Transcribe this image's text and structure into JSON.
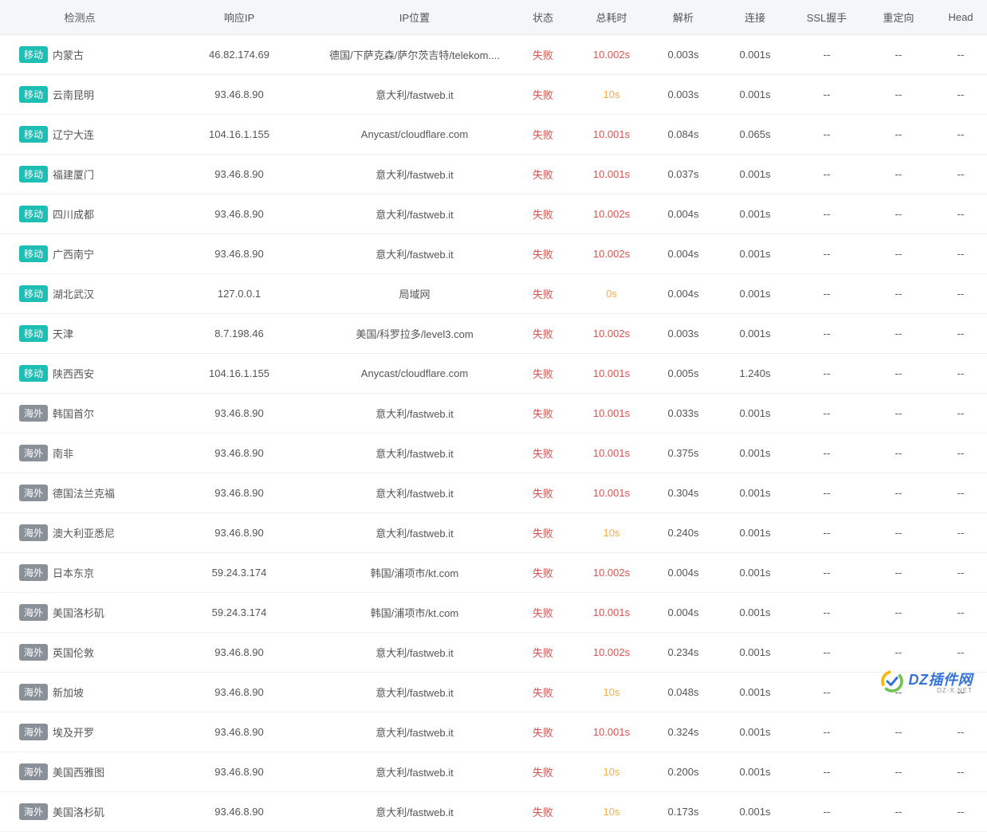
{
  "headers": {
    "checkpoint": "检测点",
    "responseIp": "响应IP",
    "ipLocation": "IP位置",
    "status": "状态",
    "totalTime": "总耗时",
    "resolve": "解析",
    "connect": "连接",
    "sslHandshake": "SSL握手",
    "redirect": "重定向",
    "head": "Head"
  },
  "badgeLabels": {
    "mobile": "移动",
    "overseas": "海外"
  },
  "statusLabels": {
    "fail": "失败"
  },
  "watermark": {
    "main": "DZ插件网",
    "sub": "DZ-X.NET"
  },
  "rows": [
    {
      "badge": "mobile",
      "location": "内蒙古",
      "ip": "46.82.174.69",
      "iploc": "德国/下萨克森/萨尔茨吉特/telekom....",
      "status": "fail",
      "total": "10.002s",
      "totalColor": "red",
      "resolve": "0.003s",
      "connect": "0.001s",
      "ssl": "--",
      "redirect": "--",
      "head": "--"
    },
    {
      "badge": "mobile",
      "location": "云南昆明",
      "ip": "93.46.8.90",
      "iploc": "意大利/fastweb.it",
      "status": "fail",
      "total": "10s",
      "totalColor": "orange",
      "resolve": "0.003s",
      "connect": "0.001s",
      "ssl": "--",
      "redirect": "--",
      "head": "--"
    },
    {
      "badge": "mobile",
      "location": "辽宁大连",
      "ip": "104.16.1.155",
      "iploc": "Anycast/cloudflare.com",
      "status": "fail",
      "total": "10.001s",
      "totalColor": "red",
      "resolve": "0.084s",
      "connect": "0.065s",
      "ssl": "--",
      "redirect": "--",
      "head": "--"
    },
    {
      "badge": "mobile",
      "location": "福建厦门",
      "ip": "93.46.8.90",
      "iploc": "意大利/fastweb.it",
      "status": "fail",
      "total": "10.001s",
      "totalColor": "red",
      "resolve": "0.037s",
      "connect": "0.001s",
      "ssl": "--",
      "redirect": "--",
      "head": "--"
    },
    {
      "badge": "mobile",
      "location": "四川成都",
      "ip": "93.46.8.90",
      "iploc": "意大利/fastweb.it",
      "status": "fail",
      "total": "10.002s",
      "totalColor": "red",
      "resolve": "0.004s",
      "connect": "0.001s",
      "ssl": "--",
      "redirect": "--",
      "head": "--"
    },
    {
      "badge": "mobile",
      "location": "广西南宁",
      "ip": "93.46.8.90",
      "iploc": "意大利/fastweb.it",
      "status": "fail",
      "total": "10.002s",
      "totalColor": "red",
      "resolve": "0.004s",
      "connect": "0.001s",
      "ssl": "--",
      "redirect": "--",
      "head": "--"
    },
    {
      "badge": "mobile",
      "location": "湖北武汉",
      "ip": "127.0.0.1",
      "iploc": "局域网",
      "status": "fail",
      "total": "0s",
      "totalColor": "orange",
      "resolve": "0.004s",
      "connect": "0.001s",
      "ssl": "--",
      "redirect": "--",
      "head": "--"
    },
    {
      "badge": "mobile",
      "location": "天津",
      "ip": "8.7.198.46",
      "iploc": "美国/科罗拉多/level3.com",
      "status": "fail",
      "total": "10.002s",
      "totalColor": "red",
      "resolve": "0.003s",
      "connect": "0.001s",
      "ssl": "--",
      "redirect": "--",
      "head": "--"
    },
    {
      "badge": "mobile",
      "location": "陕西西安",
      "ip": "104.16.1.155",
      "iploc": "Anycast/cloudflare.com",
      "status": "fail",
      "total": "10.001s",
      "totalColor": "red",
      "resolve": "0.005s",
      "connect": "1.240s",
      "ssl": "--",
      "redirect": "--",
      "head": "--"
    },
    {
      "badge": "overseas",
      "location": "韩国首尔",
      "ip": "93.46.8.90",
      "iploc": "意大利/fastweb.it",
      "status": "fail",
      "total": "10.001s",
      "totalColor": "red",
      "resolve": "0.033s",
      "connect": "0.001s",
      "ssl": "--",
      "redirect": "--",
      "head": "--"
    },
    {
      "badge": "overseas",
      "location": "南非",
      "ip": "93.46.8.90",
      "iploc": "意大利/fastweb.it",
      "status": "fail",
      "total": "10.001s",
      "totalColor": "red",
      "resolve": "0.375s",
      "connect": "0.001s",
      "ssl": "--",
      "redirect": "--",
      "head": "--"
    },
    {
      "badge": "overseas",
      "location": "德国法兰克福",
      "ip": "93.46.8.90",
      "iploc": "意大利/fastweb.it",
      "status": "fail",
      "total": "10.001s",
      "totalColor": "red",
      "resolve": "0.304s",
      "connect": "0.001s",
      "ssl": "--",
      "redirect": "--",
      "head": "--"
    },
    {
      "badge": "overseas",
      "location": "澳大利亚悉尼",
      "ip": "93.46.8.90",
      "iploc": "意大利/fastweb.it",
      "status": "fail",
      "total": "10s",
      "totalColor": "orange",
      "resolve": "0.240s",
      "connect": "0.001s",
      "ssl": "--",
      "redirect": "--",
      "head": "--"
    },
    {
      "badge": "overseas",
      "location": "日本东京",
      "ip": "59.24.3.174",
      "iploc": "韩国/浦项市/kt.com",
      "status": "fail",
      "total": "10.002s",
      "totalColor": "red",
      "resolve": "0.004s",
      "connect": "0.001s",
      "ssl": "--",
      "redirect": "--",
      "head": "--"
    },
    {
      "badge": "overseas",
      "location": "美国洛杉矶",
      "ip": "59.24.3.174",
      "iploc": "韩国/浦项市/kt.com",
      "status": "fail",
      "total": "10.001s",
      "totalColor": "red",
      "resolve": "0.004s",
      "connect": "0.001s",
      "ssl": "--",
      "redirect": "--",
      "head": "--"
    },
    {
      "badge": "overseas",
      "location": "英国伦敦",
      "ip": "93.46.8.90",
      "iploc": "意大利/fastweb.it",
      "status": "fail",
      "total": "10.002s",
      "totalColor": "red",
      "resolve": "0.234s",
      "connect": "0.001s",
      "ssl": "--",
      "redirect": "--",
      "head": "--"
    },
    {
      "badge": "overseas",
      "location": "新加坡",
      "ip": "93.46.8.90",
      "iploc": "意大利/fastweb.it",
      "status": "fail",
      "total": "10s",
      "totalColor": "orange",
      "resolve": "0.048s",
      "connect": "0.001s",
      "ssl": "--",
      "redirect": "--",
      "head": "--"
    },
    {
      "badge": "overseas",
      "location": "埃及开罗",
      "ip": "93.46.8.90",
      "iploc": "意大利/fastweb.it",
      "status": "fail",
      "total": "10.001s",
      "totalColor": "red",
      "resolve": "0.324s",
      "connect": "0.001s",
      "ssl": "--",
      "redirect": "--",
      "head": "--"
    },
    {
      "badge": "overseas",
      "location": "美国西雅图",
      "ip": "93.46.8.90",
      "iploc": "意大利/fastweb.it",
      "status": "fail",
      "total": "10s",
      "totalColor": "orange",
      "resolve": "0.200s",
      "connect": "0.001s",
      "ssl": "--",
      "redirect": "--",
      "head": "--"
    },
    {
      "badge": "overseas",
      "location": "美国洛杉矶",
      "ip": "93.46.8.90",
      "iploc": "意大利/fastweb.it",
      "status": "fail",
      "total": "10s",
      "totalColor": "orange",
      "resolve": "0.173s",
      "connect": "0.001s",
      "ssl": "--",
      "redirect": "--",
      "head": "--"
    }
  ]
}
